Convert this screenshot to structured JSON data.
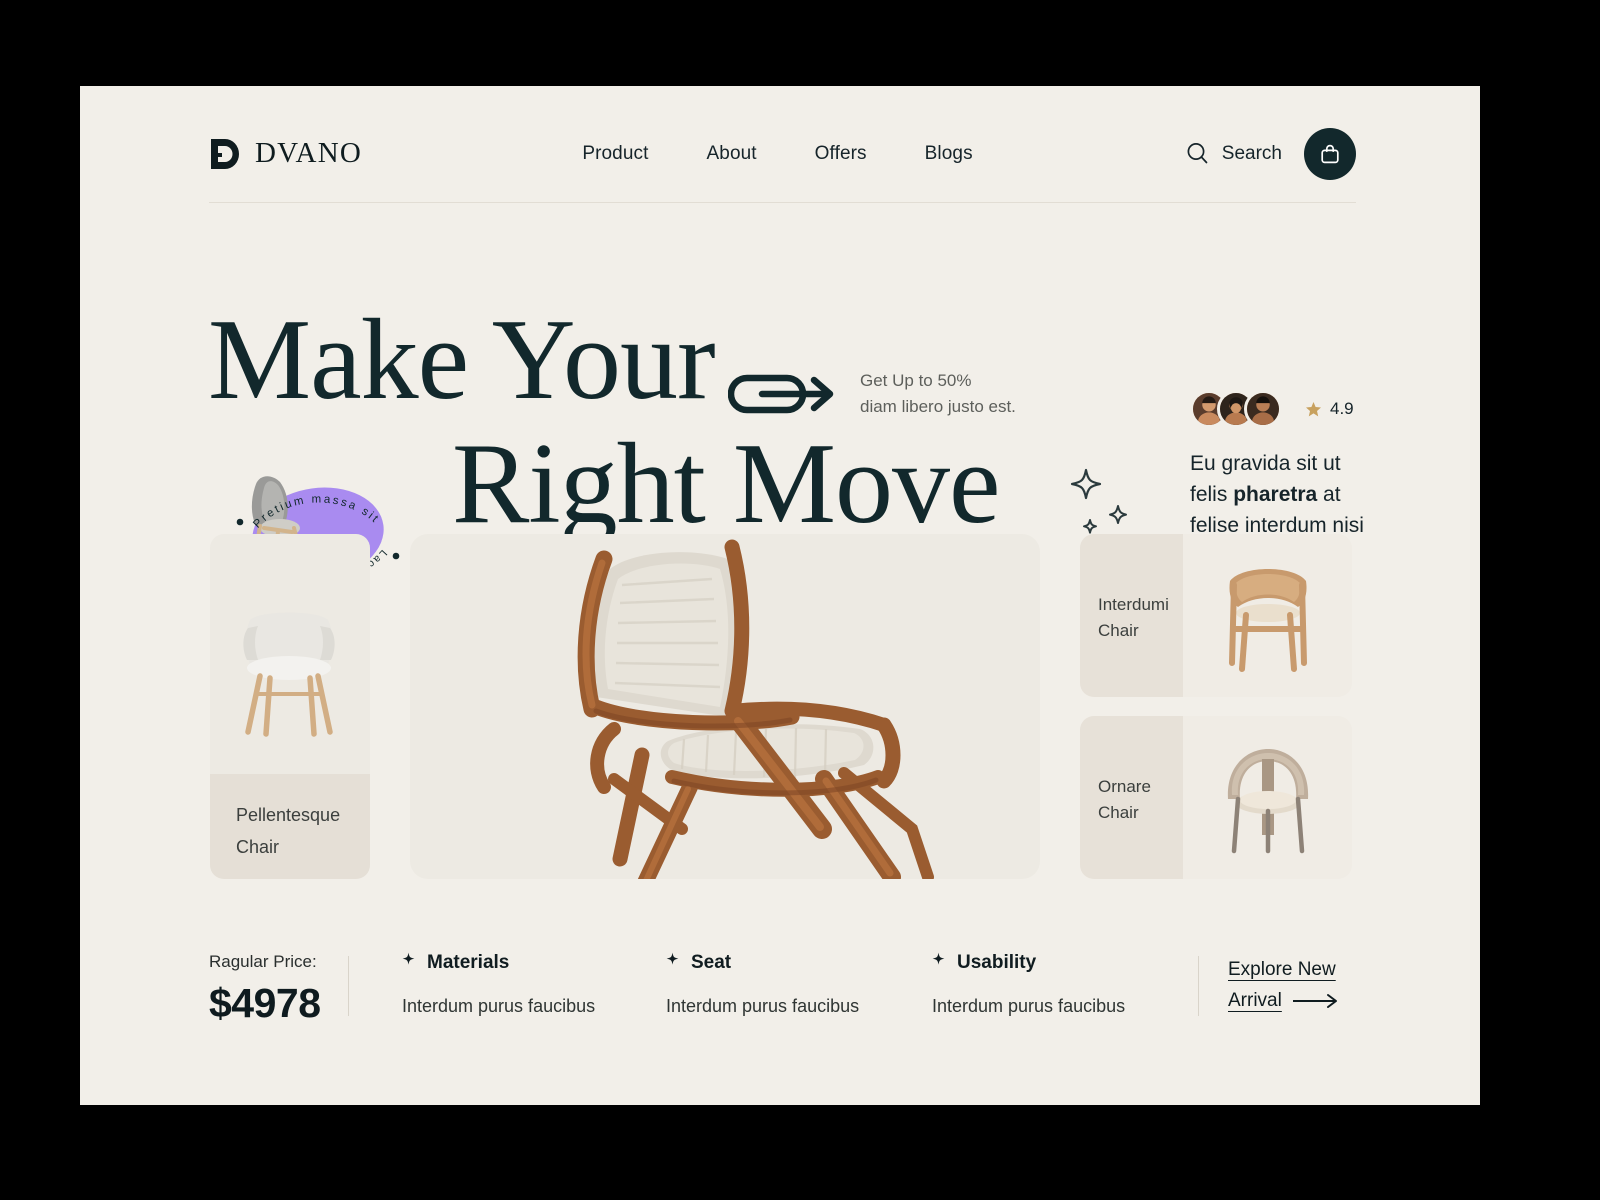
{
  "brand": {
    "name": "DVANO",
    "logo_icon": "dvano-d-mark"
  },
  "nav": {
    "items": [
      {
        "label": "Product"
      },
      {
        "label": "About"
      },
      {
        "label": "Offers"
      },
      {
        "label": "Blogs"
      }
    ]
  },
  "header": {
    "search_label": "Search",
    "search_icon": "magnifier-icon",
    "cart_icon": "shopping-bag-icon"
  },
  "hero": {
    "heading_line1": "Make Your",
    "heading_line2": "Right Move",
    "arrow_badge_icon": "pill-arrow-icon",
    "promo_line1": "Get Up to 50%",
    "promo_line2": "diam libero justo est.",
    "sparkles_icon": "sparkles-icon",
    "stamp": {
      "top_text": "Pretium massa sit",
      "bottom_text": "Lacus interdum aenean",
      "ellipse_color": "#a98bf0",
      "image_icon": "lounge-chair-image"
    }
  },
  "testimonial": {
    "avatar_count": 3,
    "avatars_icon": "customer-avatar",
    "star_icon": "star-icon",
    "rating": "4.9",
    "text_part1": "Eu gravida sit ut felis ",
    "text_bold": "pharetra",
    "text_part2": " at felise interdum nisi"
  },
  "products": {
    "side_card": {
      "name_line1": "Pellentesque",
      "name_line2": "Chair",
      "image_icon": "white-shell-chair-image"
    },
    "main_card": {
      "image_icon": "walnut-lounge-chair-image"
    },
    "wide_cards": [
      {
        "name_line1": "Interdumi",
        "name_line2": "Chair",
        "image_icon": "oak-armchair-image"
      },
      {
        "name_line1": "Ornare",
        "name_line2": "Chair",
        "image_icon": "round-back-chair-image"
      }
    ]
  },
  "footer": {
    "price_label": "Ragular Price:",
    "price_value": "$4978",
    "specs": [
      {
        "icon": "sparkle-bullet-icon",
        "title": "Materials",
        "desc": "Interdum purus faucibus"
      },
      {
        "icon": "sparkle-bullet-icon",
        "title": "Seat",
        "desc": "Interdum purus faucibus"
      },
      {
        "icon": "sparkle-bullet-icon",
        "title": "Usability",
        "desc": "Interdum purus faucibus"
      }
    ],
    "explore_line1": "Explore New",
    "explore_line2": "Arrival",
    "explore_arrow_icon": "arrow-right-icon"
  },
  "colors": {
    "page_bg": "#f2efe9",
    "frame": "#000000",
    "ink": "#12282c",
    "card_bg": "#edeae3",
    "card_label_bg": "#e5dfd6",
    "accent_purple": "#a98bf0",
    "star": "#c8a15e"
  }
}
